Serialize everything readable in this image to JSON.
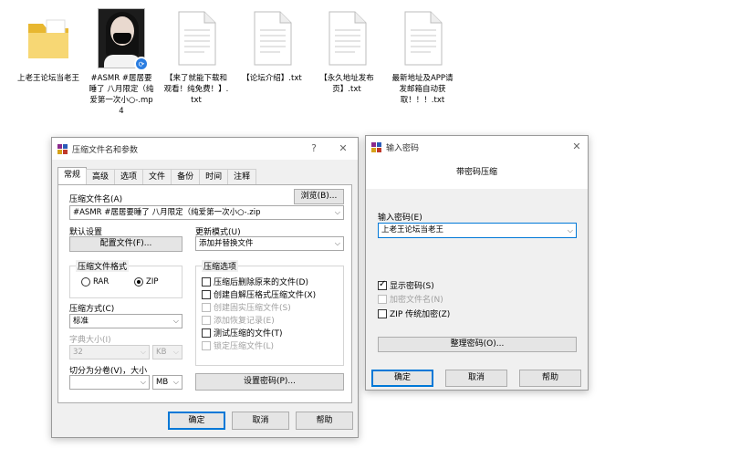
{
  "desktop": {
    "icons": [
      {
        "label": "上老王论坛当老王"
      },
      {
        "label": "#ASMR #居居要睡了 八月限定（纯爱第一次小○-.mp4"
      },
      {
        "label": "【来了就能下载和观看！纯免费！】.txt"
      },
      {
        "label": "【论坛介绍】.txt"
      },
      {
        "label": "【永久地址发布页】.txt"
      },
      {
        "label": "最新地址及APP请发邮箱自动获取！！！.txt"
      }
    ]
  },
  "archive_dialog": {
    "title": "压缩文件名和参数",
    "help_glyph": "?",
    "close_glyph": "✕",
    "tabs": [
      "常规",
      "高级",
      "选项",
      "文件",
      "备份",
      "时间",
      "注释"
    ],
    "archive_name_label": "压缩文件名(A)",
    "browse_label": "浏览(B)...",
    "archive_name_value": "#ASMR #居居要睡了 八月限定（纯爱第一次小○-.zip",
    "default_profile_label": "默认设置",
    "profile_button_label": "配置文件(F)...",
    "update_mode_label": "更新模式(U)",
    "update_mode_value": "添加并替换文件",
    "format_group_label": "压缩文件格式",
    "format_rar": "RAR",
    "format_zip": "ZIP",
    "method_label": "压缩方式(C)",
    "method_value": "标准",
    "dict_label": "字典大小(I)",
    "dict_value": "32",
    "dict_unit": "KB",
    "split_label": "切分为分卷(V)，大小",
    "split_value": "",
    "split_unit": "MB",
    "options_group_label": "压缩选项",
    "options": [
      {
        "label": "压缩后删除原来的文件(D)",
        "checked": false,
        "disabled": false
      },
      {
        "label": "创建自解压格式压缩文件(X)",
        "checked": false,
        "disabled": false
      },
      {
        "label": "创建固实压缩文件(S)",
        "checked": false,
        "disabled": true
      },
      {
        "label": "添加恢复记录(E)",
        "checked": false,
        "disabled": true
      },
      {
        "label": "测试压缩的文件(T)",
        "checked": false,
        "disabled": false
      },
      {
        "label": "锁定压缩文件(L)",
        "checked": false,
        "disabled": true
      }
    ],
    "set_password_label": "设置密码(P)...",
    "ok_label": "确定",
    "cancel_label": "取消",
    "help_label": "帮助"
  },
  "password_dialog": {
    "title": "输入密码",
    "close_glyph": "✕",
    "header": "带密码压缩",
    "enter_password_label": "输入密码(E)",
    "password_value": "上老王论坛当老王",
    "show_password_label": "显示密码(S)",
    "show_password_checked": true,
    "encrypt_names_label": "加密文件名(N)",
    "zip_legacy_label": "ZIP 传统加密(Z)",
    "organize_label": "整理密码(O)...",
    "ok_label": "确定",
    "cancel_label": "取消",
    "help_label": "帮助"
  },
  "colors": {
    "accent": "#0078d7",
    "folder": "#f2c94c"
  }
}
